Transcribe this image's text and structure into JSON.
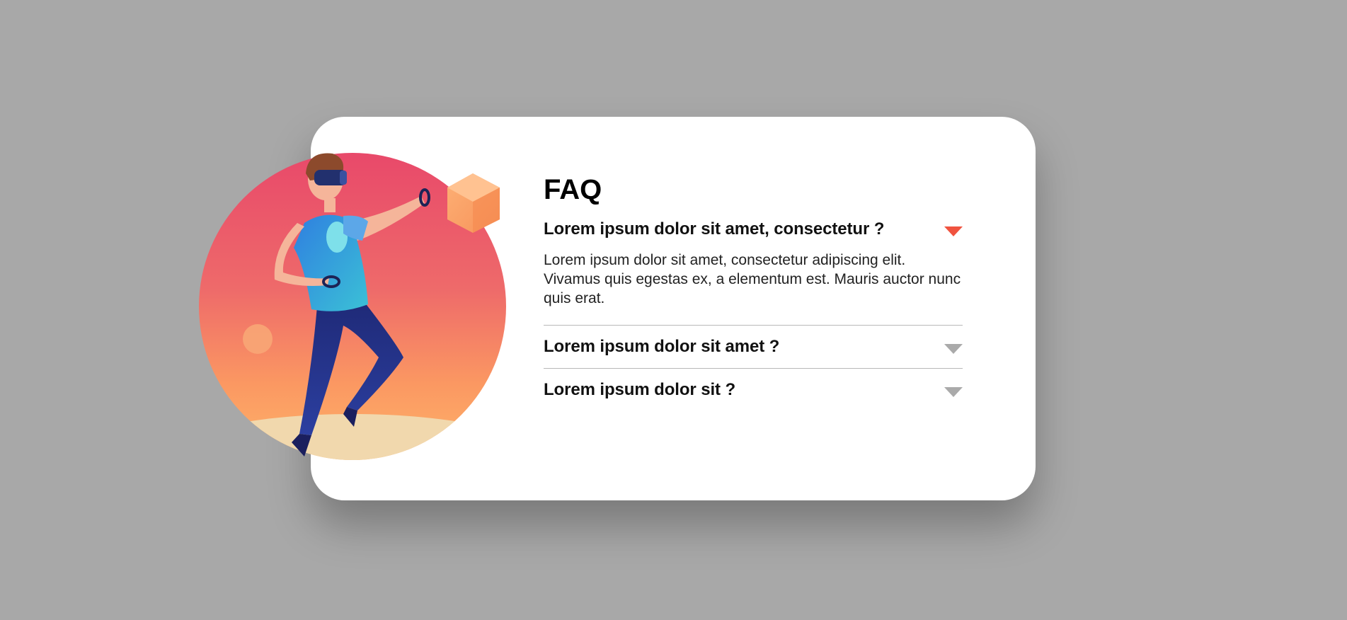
{
  "faq": {
    "title": "FAQ",
    "items": [
      {
        "question": "Lorem ipsum dolor sit amet, consectetur ?",
        "answer": "Lorem ipsum dolor sit amet, consectetur adipiscing elit. Vivamus quis egestas ex, a elementum est. Mauris auctor nunc quis erat.",
        "expanded": true
      },
      {
        "question": "Lorem ipsum dolor sit amet ?",
        "expanded": false
      },
      {
        "question": "Lorem ipsum dolor sit ?",
        "expanded": false
      }
    ]
  },
  "colors": {
    "background": "#a8a8a8",
    "card": "#ffffff",
    "accent_arrow": "#f0533f",
    "muted_arrow": "#aaaaaa"
  },
  "icons": {
    "expanded": "caret-down-icon-active",
    "collapsed": "caret-down-icon"
  }
}
